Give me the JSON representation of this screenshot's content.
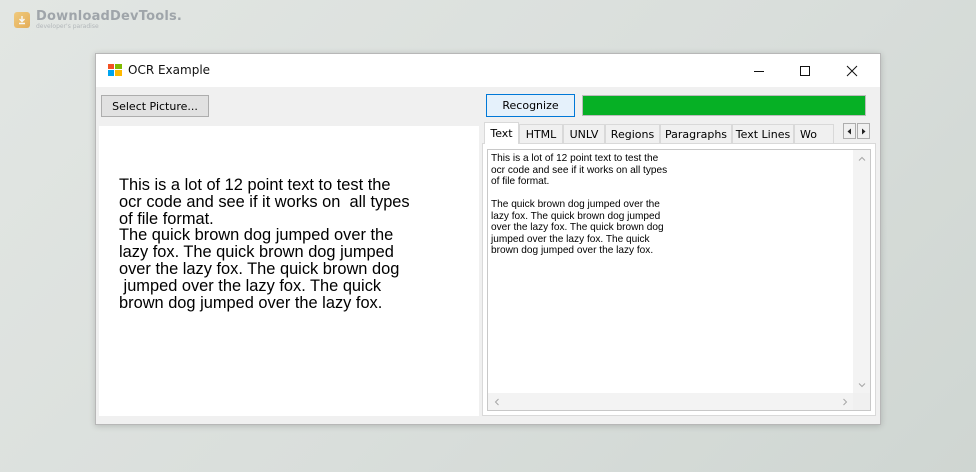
{
  "watermark": {
    "name": "DownloadDevTools.",
    "tagline": "developer's paradise"
  },
  "window": {
    "title": "OCR Example",
    "controls": {
      "minimize": "minimize-icon",
      "maximize": "maximize-icon",
      "close": "close-icon"
    }
  },
  "toolbar": {
    "select_label": "Select Picture...",
    "recognize_label": "Recognize",
    "progress_percent": 100,
    "progress_color": "#06b025"
  },
  "picture": {
    "text": "This is a lot of 12 point text to test the\nocr code and see if it works on  all types\nof file format.\nThe quick brown dog jumped over the\nlazy fox. The quick brown dog jumped\nover the lazy fox. The quick brown dog\n jumped over the lazy fox. The quick\nbrown dog jumped over the lazy fox."
  },
  "tabs": [
    {
      "label": "Text"
    },
    {
      "label": "HTML"
    },
    {
      "label": "UNLV"
    },
    {
      "label": "Regions"
    },
    {
      "label": "Paragraphs"
    },
    {
      "label": "Text Lines"
    },
    {
      "label": "Wo"
    }
  ],
  "active_tab": "Text",
  "result": {
    "text": "This is a lot of 12 point text to test the\nocr code and see if it works on all types\nof file format.\n\nThe quick brown dog jumped over the\nlazy fox. The quick brown dog jumped\nover the lazy fox. The quick brown dog\njumped over the lazy fox. The quick\nbrown dog jumped over the lazy fox."
  }
}
